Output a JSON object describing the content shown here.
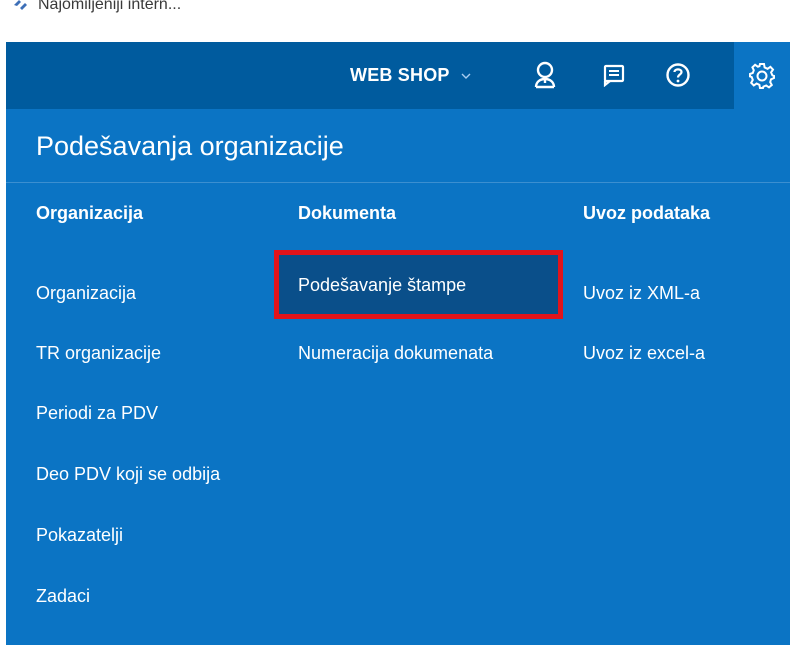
{
  "bookmark_bar": {
    "item_label": "Najomiljeniji intern...",
    "item_icon": "bookmark-folder-icon"
  },
  "topbar": {
    "webshop_label": "WEB SHOP",
    "icons": [
      "chevron-down-icon",
      "user-icon",
      "messages-icon",
      "help-icon",
      "gear-icon"
    ],
    "bar_color": "#005b9e",
    "active_tile_color": "#0b74c4"
  },
  "panel": {
    "title": "Podešavanja organizacije",
    "background": "#0b74c4",
    "columns": [
      {
        "heading": "Organizacija",
        "links": [
          "Organizacija",
          "TR organizacije",
          "Periodi za PDV",
          "Deo PDV koji se odbija",
          "Pokazatelji",
          "Zadaci"
        ]
      },
      {
        "heading": "Dokumenta",
        "links": [
          "Podešavanje štampe",
          "Numeracija dokumenata"
        ]
      },
      {
        "heading": "Uvoz podataka",
        "links": [
          "Uvoz iz XML-a",
          "Uvoz iz excel-a"
        ]
      }
    ],
    "highlight_color": "#e2141b"
  }
}
